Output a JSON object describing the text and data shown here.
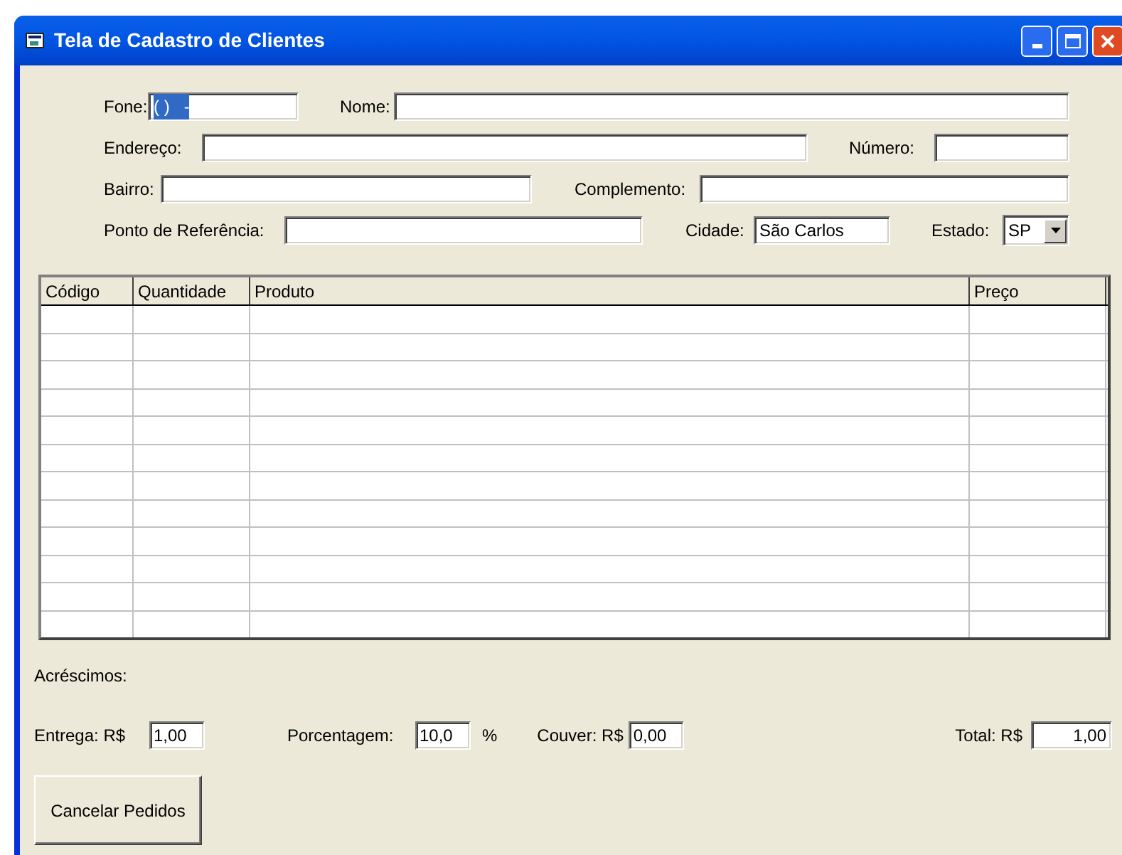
{
  "window": {
    "title": "Tela de Cadastro de Clientes"
  },
  "form_rows": [
    [
      {
        "kind": "text",
        "label": "Fone:",
        "value": "( )   -",
        "highlighted": true
      },
      {
        "kind": "text",
        "label": "Nome:"
      }
    ],
    [
      {
        "kind": "text",
        "label": "Endereço:"
      },
      {
        "kind": "text",
        "label": "Número:"
      }
    ],
    [
      {
        "kind": "text",
        "label": "Bairro:"
      },
      {
        "kind": "text",
        "label": "Complemento:"
      }
    ],
    [
      {
        "kind": "text",
        "label": "Ponto de Referência:"
      },
      {
        "kind": "text",
        "label": "Cidade:",
        "value": "São Carlos",
        "highlighted": false
      },
      {
        "kind": "dropdown",
        "label": "Estado:",
        "value": "SP",
        "highlighted": false
      }
    ]
  ],
  "table": {
    "columns": [
      "Código",
      "Quantidade",
      "Produto",
      "Preço"
    ]
  },
  "additions": {
    "title": "Acréscimos:",
    "fields": [
      {
        "label": "Entrega: R$",
        "value": "1,00"
      },
      {
        "label": "Porcentagem:",
        "value": "10,0",
        "suffix": "%"
      },
      {
        "label": "Couver: R$",
        "value": "0,00"
      }
    ]
  },
  "total": {
    "label": "Total: R$",
    "value": "1,00"
  },
  "button": "Cancelar Pedidos"
}
